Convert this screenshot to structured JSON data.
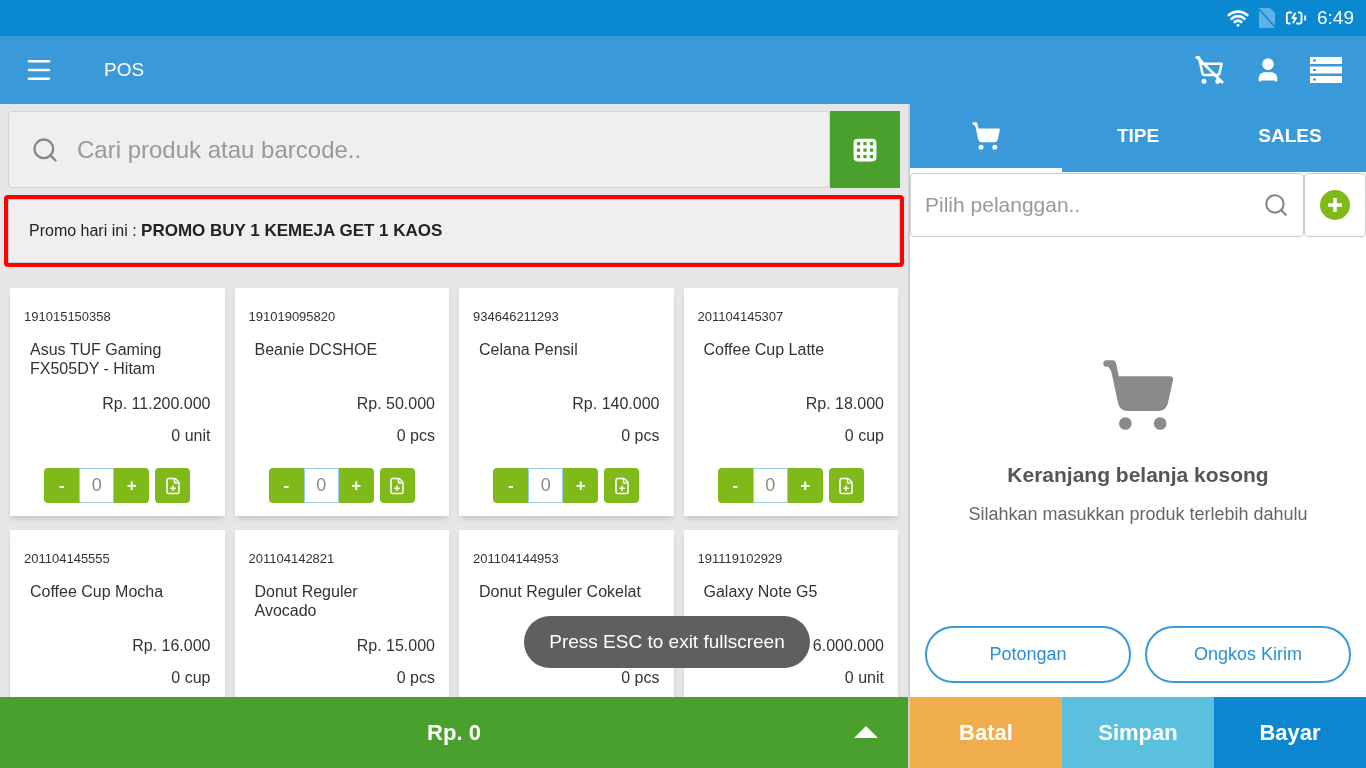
{
  "status_bar": {
    "time": "6:49"
  },
  "app_bar": {
    "title": "POS"
  },
  "search": {
    "placeholder": "Cari produk atau barcode.."
  },
  "promo": {
    "label": "Promo hari ini : ",
    "value": "PROMO BUY 1 KEMEJA GET 1 KAOS"
  },
  "products": [
    {
      "code": "191015150358",
      "name": "Asus TUF Gaming\nFX505DY - Hitam",
      "price": "Rp. 11.200.000",
      "stock": "0 unit",
      "minus": "-",
      "quantity": "0",
      "plus": "+"
    },
    {
      "code": "191019095820",
      "name": "Beanie DCSHOE",
      "price": "Rp. 50.000",
      "stock": "0 pcs",
      "minus": "-",
      "quantity": "0",
      "plus": "+"
    },
    {
      "code": "934646211293",
      "name": "Celana Pensil",
      "price": "Rp. 140.000",
      "stock": "0 pcs",
      "minus": "-",
      "quantity": "0",
      "plus": "+"
    },
    {
      "code": "201104145307",
      "name": "Coffee Cup Latte",
      "price": "Rp. 18.000",
      "stock": "0 cup",
      "minus": "-",
      "quantity": "0",
      "plus": "+"
    },
    {
      "code": "201104145555",
      "name": "Coffee Cup Mocha",
      "price": "Rp. 16.000",
      "stock": "0 cup"
    },
    {
      "code": "201104142821",
      "name": "Donut Reguler\nAvocado",
      "price": "Rp. 15.000",
      "stock": "0 pcs"
    },
    {
      "code": "201104144953",
      "name": "Donut Reguler Cokelat",
      "stock": "0 pcs"
    },
    {
      "code": "191119102929",
      "name": "Galaxy Note G5",
      "price": "6.000.000",
      "stock": "0 unit"
    }
  ],
  "toast": "Press ESC to exit fullscreen",
  "total": "Rp. 0",
  "tabs": [
    {
      "kind": "icon",
      "selected": true
    },
    {
      "kind": "text",
      "label": "TIPE",
      "selected": false
    },
    {
      "kind": "text",
      "label": "SALES",
      "selected": false
    }
  ],
  "customer": {
    "placeholder": "Pilih pelanggan.."
  },
  "empty_cart": {
    "title": "Keranjang belanja kosong",
    "message": "Silahkan masukkan produk terlebih dahulu"
  },
  "actions": [
    "Potongan",
    "Ongkos Kirim"
  ],
  "footer_buttons": [
    {
      "label": "Batal",
      "color": "#f0ad4e"
    },
    {
      "label": "Simpan",
      "color": "#5bc0de"
    },
    {
      "label": "Bayar",
      "color": "#0c86cf"
    }
  ]
}
